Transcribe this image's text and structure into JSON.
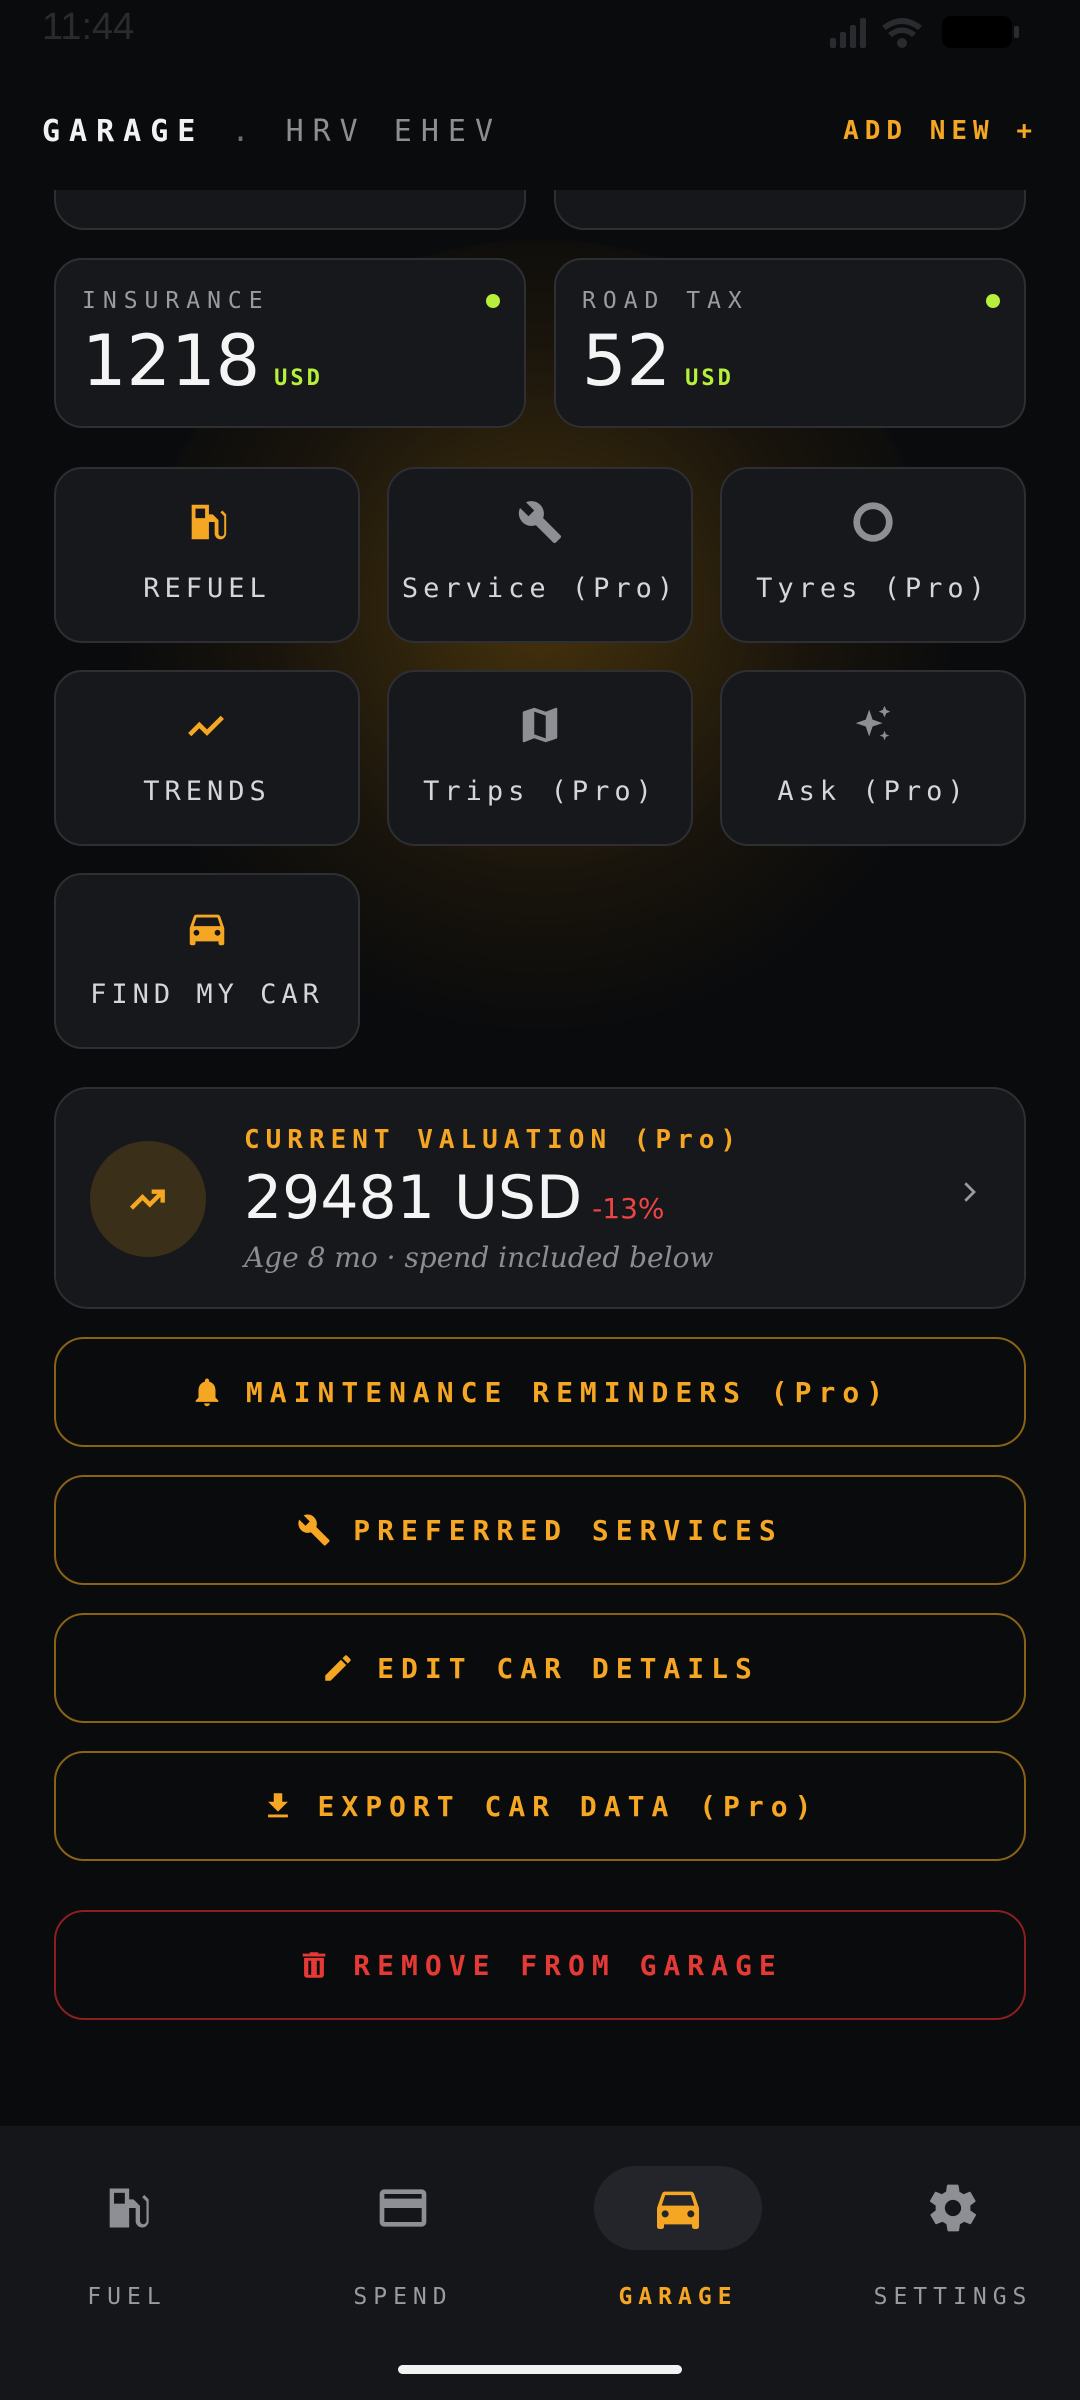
{
  "status_bar": {
    "time": "11:44"
  },
  "header": {
    "title": "GARAGE",
    "separator": ".",
    "car_name": "HRV EHEV",
    "add_new": "ADD NEW +"
  },
  "stats": [
    {
      "label": "INSURANCE",
      "value": "1218",
      "unit": "USD"
    },
    {
      "label": "ROAD TAX",
      "value": "52",
      "unit": "USD"
    }
  ],
  "tiles": [
    {
      "label": "REFUEL",
      "icon": "fuel-pump-icon"
    },
    {
      "label": "Service (Pro)",
      "icon": "wrench-icon"
    },
    {
      "label": "Tyres (Pro)",
      "icon": "tyre-ring-icon"
    },
    {
      "label": "TRENDS",
      "icon": "trend-line-icon"
    },
    {
      "label": "Trips (Pro)",
      "icon": "map-icon"
    },
    {
      "label": "Ask (Pro)",
      "icon": "sparkle-icon"
    },
    {
      "label": "FIND MY CAR",
      "icon": "car-icon"
    }
  ],
  "valuation": {
    "label": "CURRENT VALUATION (Pro)",
    "amount": "29481 USD",
    "change": "-13%",
    "subtitle": "Age 8 mo · spend included below"
  },
  "actions": [
    {
      "label": "MAINTENANCE REMINDERS (Pro)",
      "icon": "bell-icon"
    },
    {
      "label": "PREFERRED SERVICES",
      "icon": "wrench-icon"
    },
    {
      "label": "EDIT CAR DETAILS",
      "icon": "pencil-icon"
    },
    {
      "label": "EXPORT CAR DATA (Pro)",
      "icon": "download-icon"
    },
    {
      "label": "REMOVE FROM GARAGE",
      "icon": "trash-icon"
    }
  ],
  "nav": [
    {
      "label": "FUEL",
      "icon": "fuel-pump-icon",
      "active": false
    },
    {
      "label": "SPEND",
      "icon": "credit-card-icon",
      "active": false
    },
    {
      "label": "GARAGE",
      "icon": "car-icon",
      "active": true
    },
    {
      "label": "SETTINGS",
      "icon": "gear-icon",
      "active": false
    }
  ],
  "colors": {
    "accent": "#f5a623",
    "positive": "#b7f03a",
    "danger": "#e53935",
    "background": "#0a0b0d",
    "card": "#17181c"
  }
}
